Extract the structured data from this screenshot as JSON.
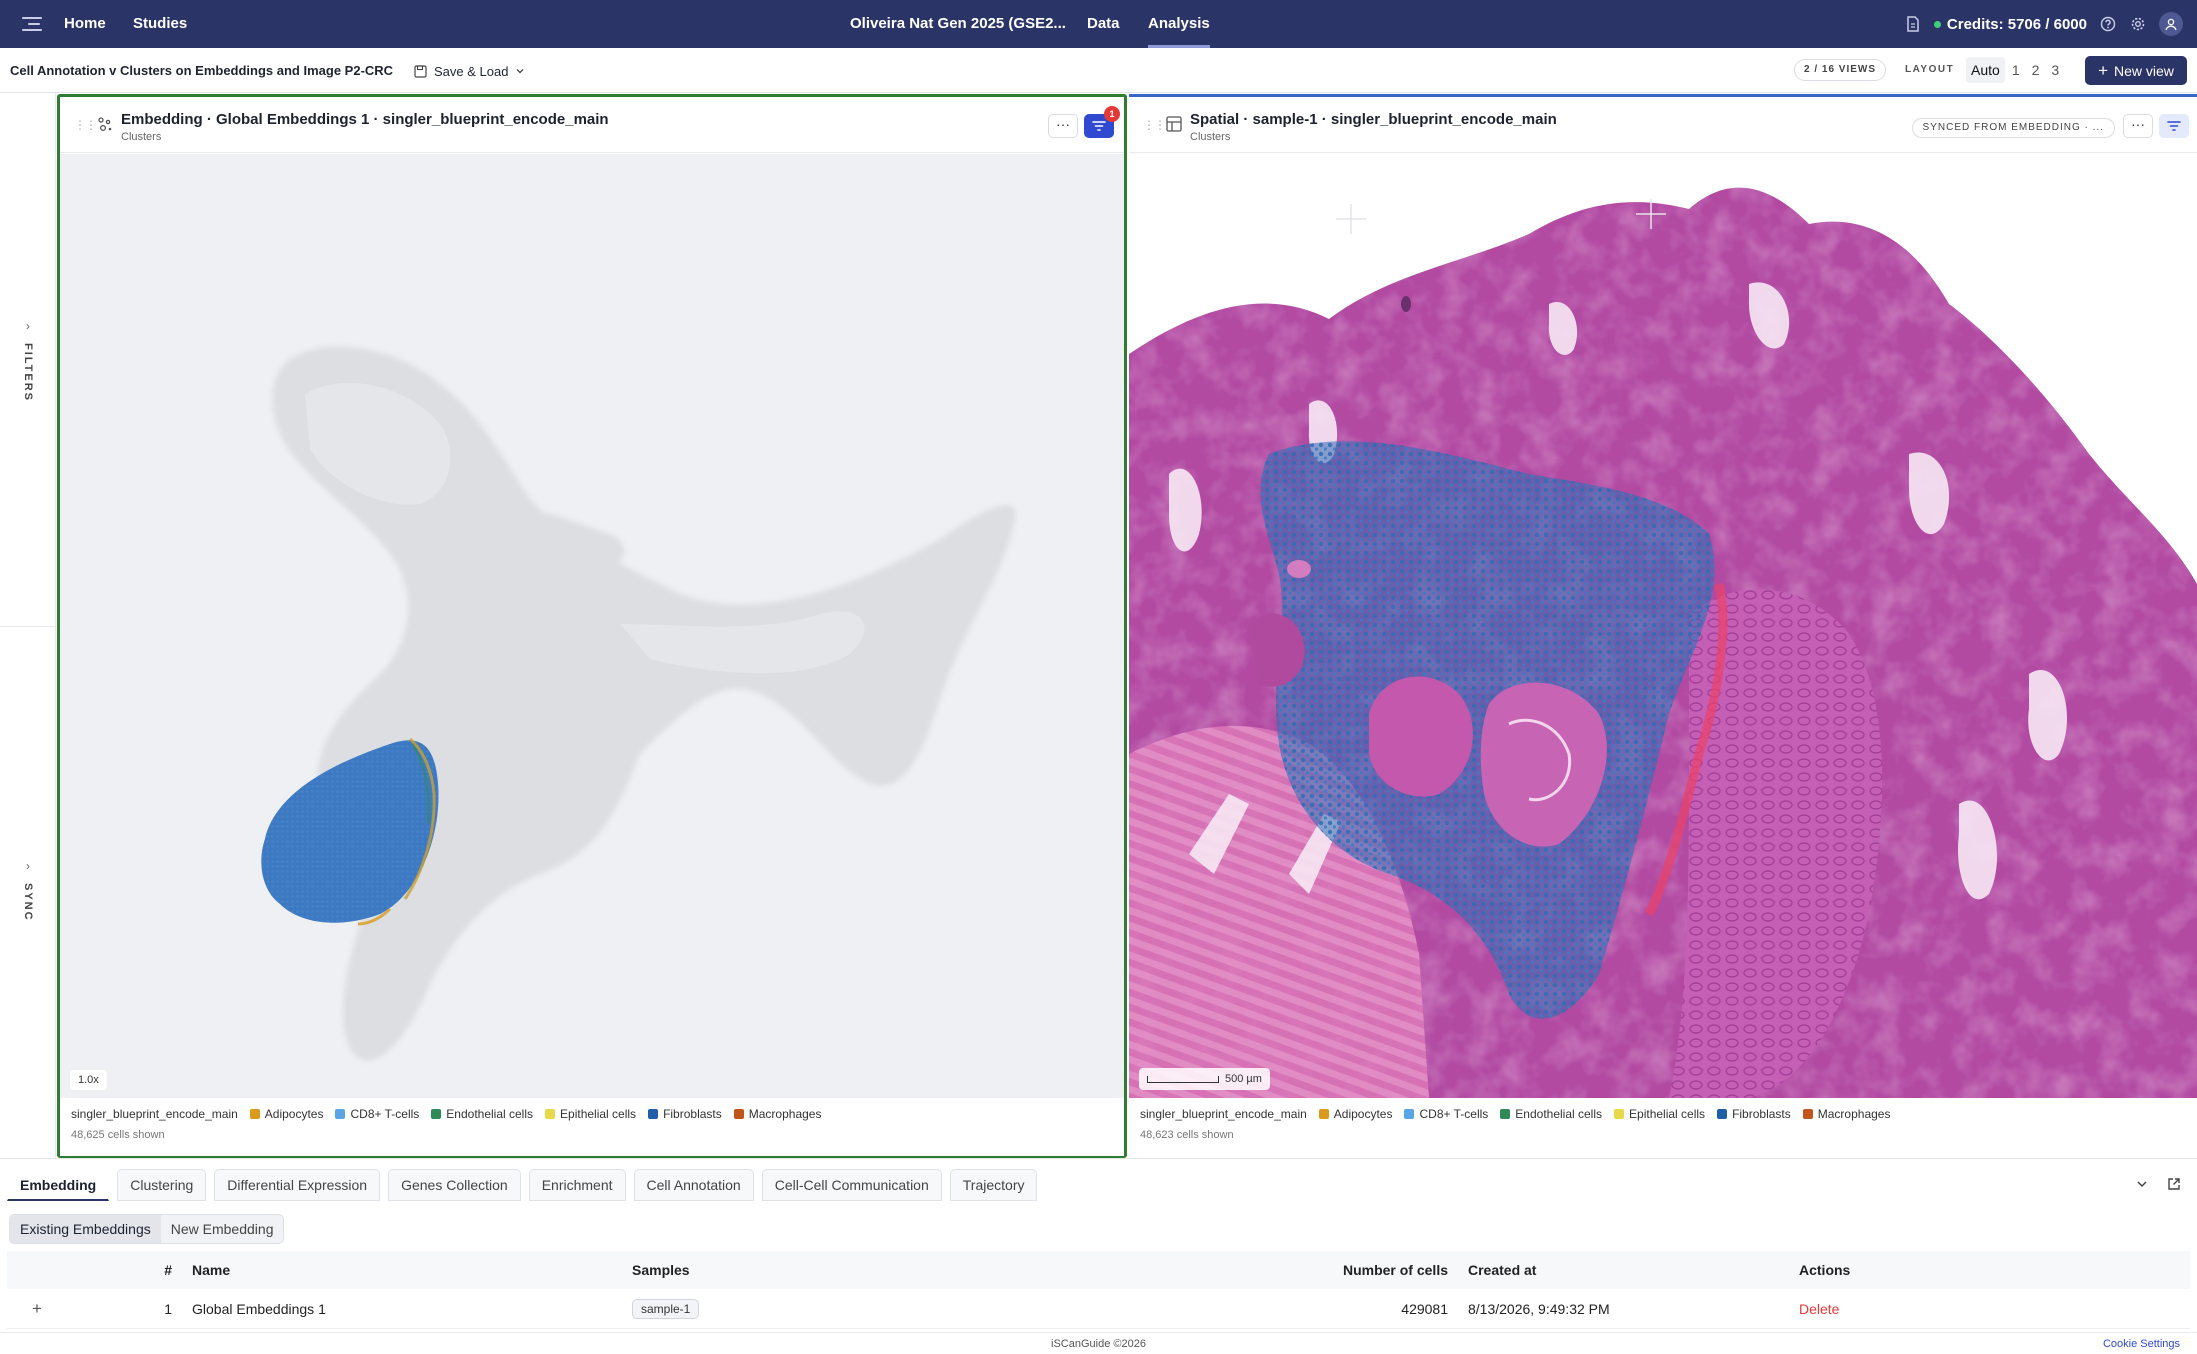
{
  "nav": {
    "home": "Home",
    "studies": "Studies",
    "study_title": "Oliveira Nat Gen 2025 (GSE2...",
    "data": "Data",
    "analysis": "Analysis",
    "credits": "Credits: 5706 / 6000"
  },
  "toolbar": {
    "analysis_title": "Cell Annotation v Clusters on Embeddings and Image P2-CRC",
    "save_load": "Save & Load",
    "views_count": "2 / 16 VIEWS",
    "layout_label": "LAYOUT",
    "layout_options": [
      "Auto",
      "1",
      "2",
      "3"
    ],
    "new_view": "New view"
  },
  "rail": {
    "filters": "FILTERS",
    "sync": "SYNC"
  },
  "embedding_panel": {
    "title": "Embedding · Global Embeddings 1 · singler_blueprint_encode_main",
    "subtitle": "Clusters",
    "filter_badge": "1",
    "zoom": "1.0x",
    "legend_title": "singler_blueprint_encode_main",
    "cells_shown": "48,625 cells shown"
  },
  "spatial_panel": {
    "title": "Spatial · sample-1 · singler_blueprint_encode_main",
    "subtitle": "Clusters",
    "sync_pill": "SYNCED FROM EMBEDDING · ...",
    "scale": "500 µm",
    "legend_title": "singler_blueprint_encode_main",
    "cells_shown": "48,623 cells shown"
  },
  "legend_items": [
    {
      "label": "Adipocytes",
      "color": "#d99a1e"
    },
    {
      "label": "CD8+ T-cells",
      "color": "#5aa5e6"
    },
    {
      "label": "Endothelial cells",
      "color": "#2e8b57"
    },
    {
      "label": "Epithelial cells",
      "color": "#e8d94a"
    },
    {
      "label": "Fibroblasts",
      "color": "#1f5fa8"
    },
    {
      "label": "Macrophages",
      "color": "#c2561a"
    }
  ],
  "bottom": {
    "tabs": [
      "Embedding",
      "Clustering",
      "Differential Expression",
      "Genes Collection",
      "Enrichment",
      "Cell Annotation",
      "Cell-Cell Communication",
      "Trajectory"
    ],
    "subtabs": [
      "Existing Embeddings",
      "New Embedding"
    ],
    "columns": [
      "#",
      "Name",
      "Samples",
      "Number of cells",
      "Created at",
      "Actions"
    ],
    "rows": [
      {
        "index": "1",
        "name": "Global Embeddings 1",
        "sample": "sample-1",
        "cells": "429081",
        "created": "8/13/2026, 9:49:32 PM",
        "action": "Delete"
      }
    ]
  },
  "footer": {
    "copyright": "iSCanGuide ©2026",
    "cookie": "Cookie Settings"
  },
  "colors": {
    "nav_bg": "#2b3467",
    "embed_border": "#2e7d32",
    "spatial_border": "#3a64c8",
    "tissue": "#b84aa6",
    "cluster": "#2f6db5"
  }
}
